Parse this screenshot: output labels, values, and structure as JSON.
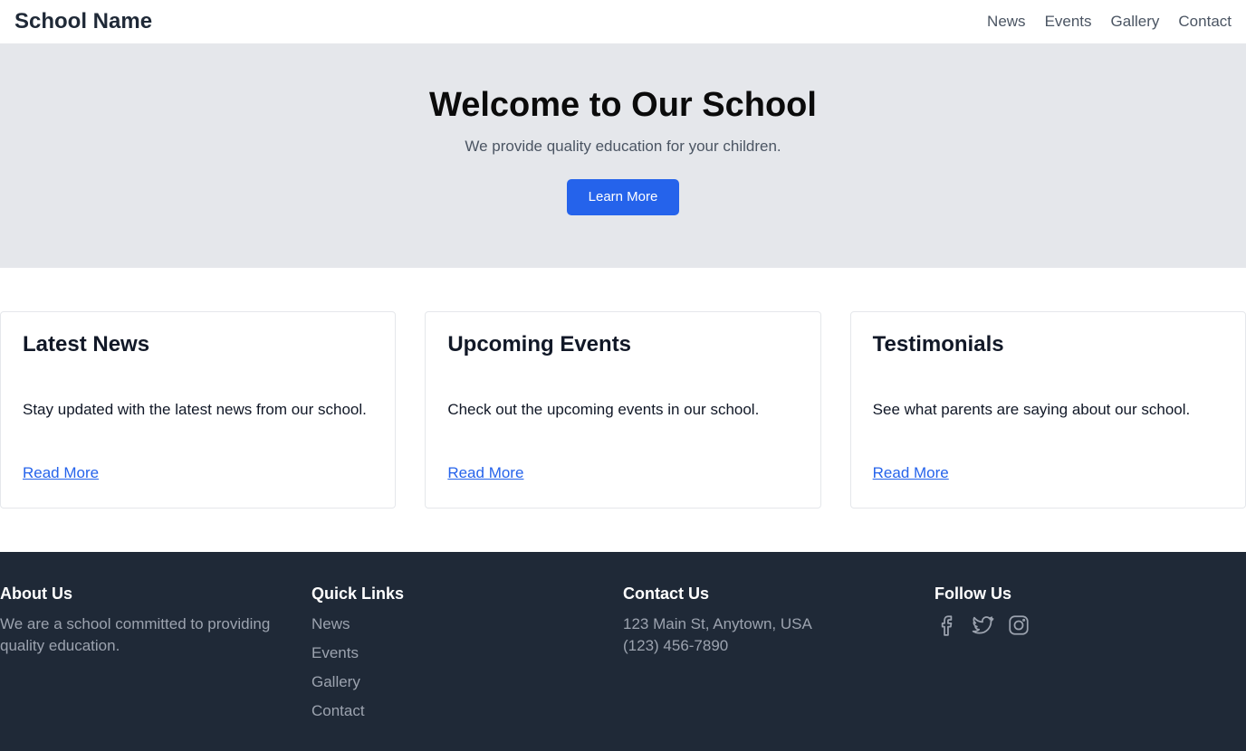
{
  "navbar": {
    "brand": "School Name",
    "links": [
      "News",
      "Events",
      "Gallery",
      "Contact"
    ]
  },
  "hero": {
    "title": "Welcome to Our School",
    "subtitle": "We provide quality education for your children.",
    "button_label": "Learn More"
  },
  "cards": [
    {
      "title": "Latest News",
      "text": "Stay updated with the latest news from our school.",
      "link": "Read More"
    },
    {
      "title": "Upcoming Events",
      "text": "Check out the upcoming events in our school.",
      "link": "Read More"
    },
    {
      "title": "Testimonials",
      "text": "See what parents are saying about our school.",
      "link": "Read More"
    }
  ],
  "footer": {
    "about": {
      "title": "About Us",
      "text": "We are a school committed to providing quality education."
    },
    "quick_links": {
      "title": "Quick Links",
      "items": [
        "News",
        "Events",
        "Gallery",
        "Contact"
      ]
    },
    "contact": {
      "title": "Contact Us",
      "address": "123 Main St, Anytown, USA",
      "phone": "(123) 456-7890"
    },
    "follow": {
      "title": "Follow Us",
      "icons": [
        "facebook-icon",
        "twitter-icon",
        "instagram-icon"
      ]
    }
  },
  "colors": {
    "accent": "#2563eb",
    "hero_bg": "#e5e7eb",
    "footer_bg": "#1f2937"
  }
}
